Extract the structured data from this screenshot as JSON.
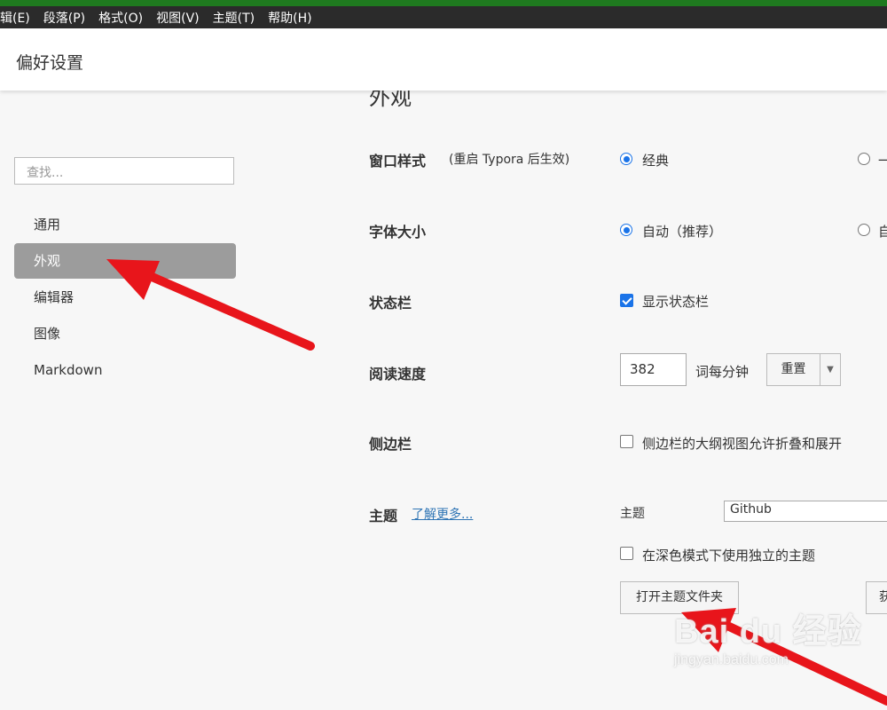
{
  "menu": [
    "辑(E)",
    "段落(P)",
    "格式(O)",
    "视图(V)",
    "主题(T)",
    "帮助(H)"
  ],
  "title": "偏好设置",
  "sidebar": {
    "search_placeholder": "查找...",
    "items": [
      {
        "label": "通用",
        "active": false
      },
      {
        "label": "外观",
        "active": true
      },
      {
        "label": "编辑器",
        "active": false
      },
      {
        "label": "图像",
        "active": false
      },
      {
        "label": "Markdown",
        "active": false
      }
    ]
  },
  "main": {
    "section_title": "外观",
    "window_style": {
      "label": "窗口样式",
      "note": "(重启 Typora 后生效)",
      "option1": "经典",
      "option1_checked": true,
      "option2": "一",
      "option2_checked": false
    },
    "font_size": {
      "label": "字体大小",
      "option1": "自动（推荐）",
      "option1_checked": true,
      "option2": "自",
      "option2_checked": false
    },
    "status_bar": {
      "label": "状态栏",
      "option": "显示状态栏",
      "checked": true
    },
    "reading_speed": {
      "label": "阅读速度",
      "value": "382",
      "unit": "词每分钟",
      "reset": "重置"
    },
    "sidebar_setting": {
      "label": "侧边栏",
      "option": "侧边栏的大纲视图允许折叠和展开",
      "checked": false
    },
    "theme": {
      "label": "主题",
      "learn_more": "了解更多...",
      "theme_label": "主题",
      "theme_value": "Github",
      "dark_option": "在深色模式下使用独立的主题",
      "dark_checked": false,
      "open_folder": "打开主题文件夹",
      "get_button": "获"
    }
  },
  "watermark": {
    "text": "Bai du 经验",
    "url": "jingyan.baidu.com"
  },
  "colors": {
    "accent": "#1a73e8",
    "annotation": "#e8151b",
    "active_nav": "#9c9c9c"
  }
}
